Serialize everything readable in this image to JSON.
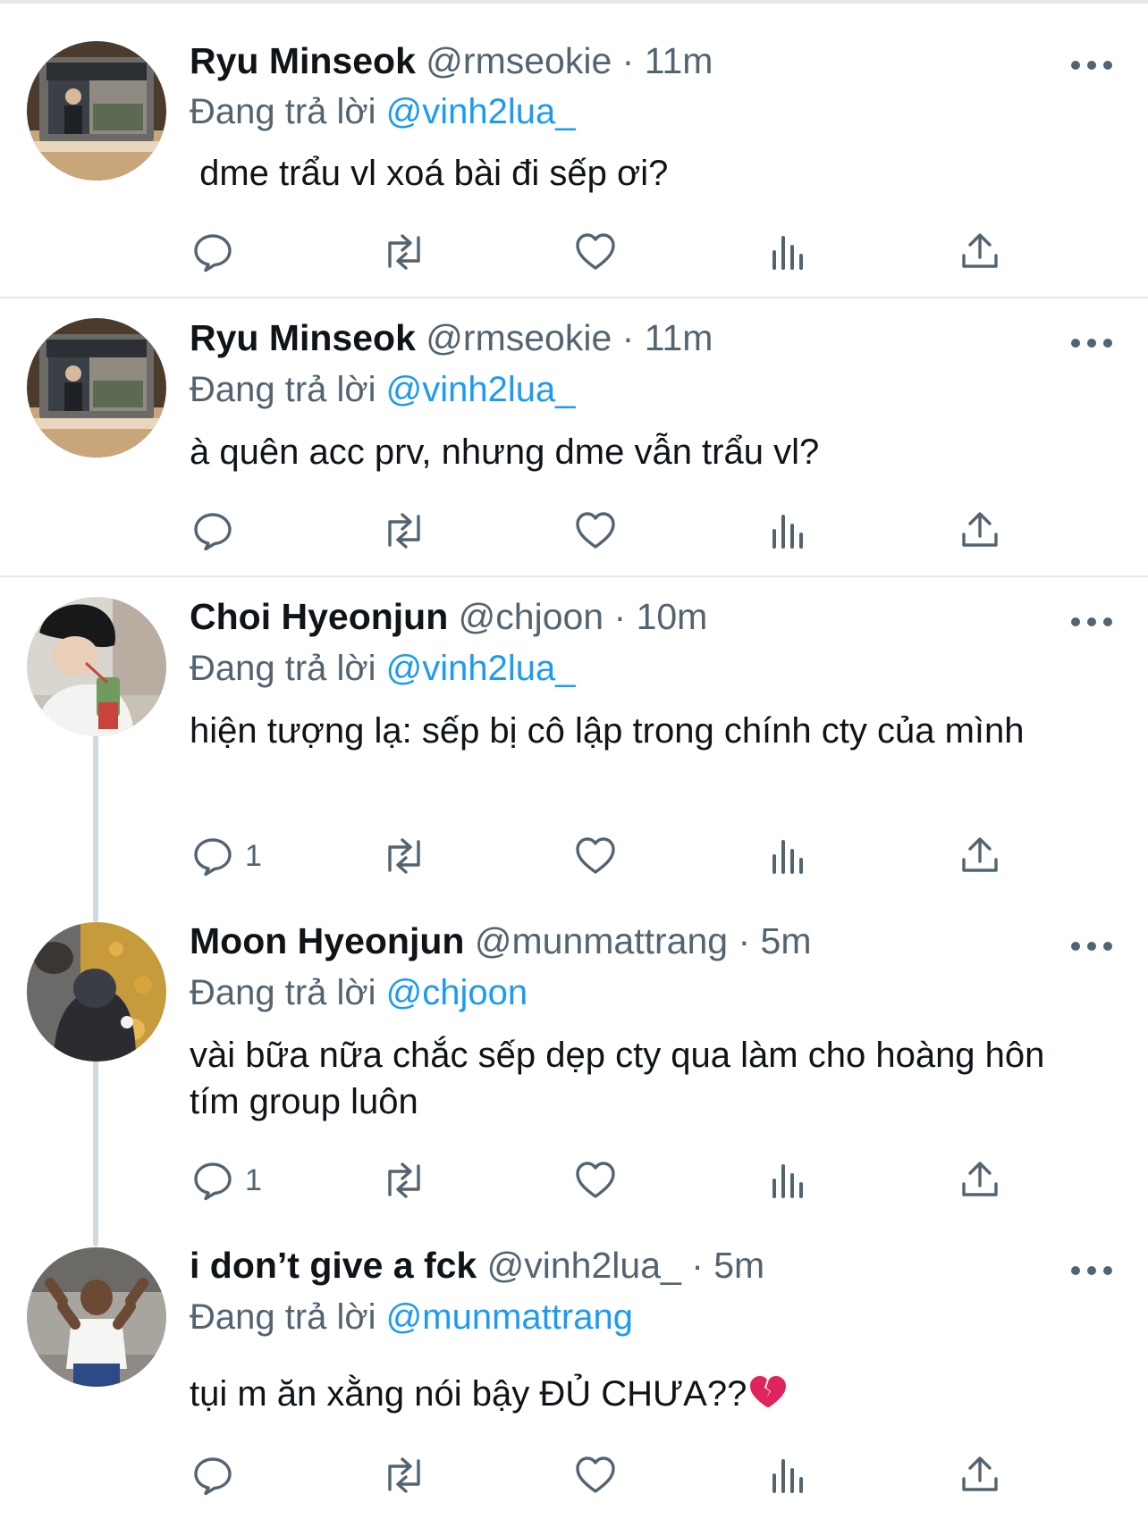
{
  "tweets": [
    {
      "name": "Ryu Minseok",
      "handle": "@rmseokie",
      "time": "· 11m",
      "reply_prefix": "Đang trả lời",
      "reply_to": "@vinh2lua_",
      "text": " dme trẩu vl xoá bài đi sếp ơi?",
      "reply_count": "",
      "avatar_icon": "mirror-selfie-avatar"
    },
    {
      "name": "Ryu Minseok",
      "handle": "@rmseokie",
      "time": "· 11m",
      "reply_prefix": "Đang trả lời",
      "reply_to": "@vinh2lua_",
      "text": "à quên acc prv, nhưng dme vẫn trẩu vl?",
      "reply_count": "",
      "avatar_icon": "mirror-selfie-avatar"
    },
    {
      "name": "Choi Hyeonjun",
      "handle": "@chjoon",
      "time": "· 10m",
      "reply_prefix": "Đang trả lời",
      "reply_to": "@vinh2lua_",
      "text": "hiện tượng lạ: sếp bị cô lập trong chính cty của mình",
      "reply_count": "1",
      "avatar_icon": "drink-straw-avatar"
    },
    {
      "name": "Moon Hyeonjun",
      "handle": "@munmattrang",
      "time": "· 5m",
      "reply_prefix": "Đang trả lời",
      "reply_to": "@chjoon",
      "text": "vài bữa nữa chắc sếp dẹp cty qua làm cho hoàng hôn tím group luôn",
      "reply_count": "1",
      "avatar_icon": "autumn-leaves-avatar"
    },
    {
      "name": "i don’t give a fck",
      "handle": "@vinh2lua_",
      "time": "· 5m",
      "reply_prefix": "Đang trả lời",
      "reply_to": "@munmattrang",
      "text": "tụi m ăn xằng nói bậy ĐỦ CHƯA??",
      "reply_count": "",
      "avatar_icon": "game-character-avatar"
    }
  ],
  "icons": {
    "reply": "reply-icon",
    "retweet": "retweet-icon",
    "like": "like-icon",
    "views": "views-icon",
    "share": "share-icon",
    "more": "more-icon",
    "emoji": "broken-heart-icon"
  },
  "colors": {
    "link": "#1d9bf0",
    "secondary": "#536471",
    "divider": "#e6e9ec",
    "broken_heart": "#e0245e"
  }
}
